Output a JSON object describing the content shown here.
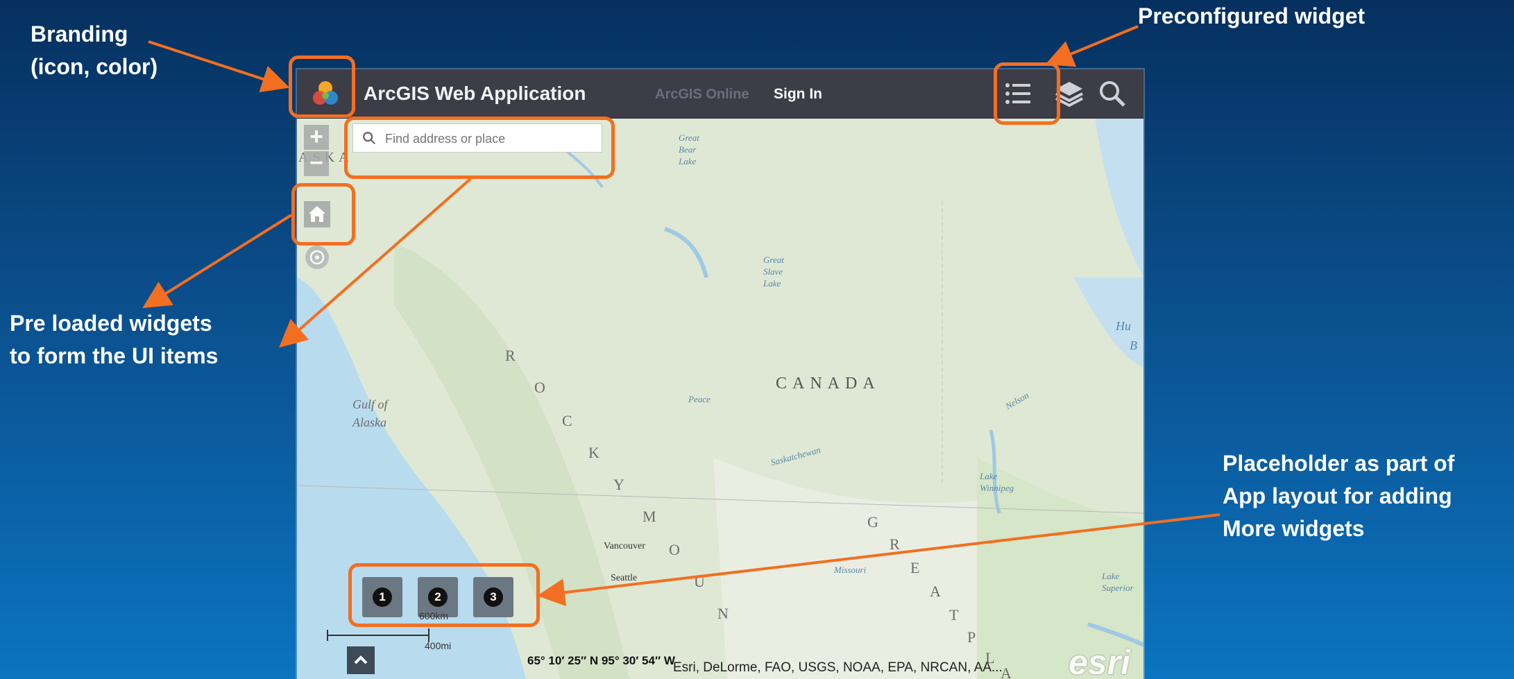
{
  "callouts": {
    "branding": [
      "Branding",
      "(icon, color)"
    ],
    "preconfigured": [
      "Preconfigured widget"
    ],
    "preloaded": [
      "Pre loaded widgets",
      "to form the UI items"
    ],
    "placeholder": [
      "Placeholder as part of",
      "App layout for adding",
      "More widgets"
    ]
  },
  "app": {
    "title": "ArcGIS Web Application",
    "org_link": "ArcGIS Online",
    "sign_in": "Sign In",
    "search": {
      "placeholder": "Find address or place"
    },
    "header_icons": [
      "list-icon",
      "layers-icon",
      "search-icon"
    ],
    "zoom": {
      "in": "+",
      "out": "−"
    },
    "placeholder_widgets": [
      "1",
      "2",
      "3"
    ],
    "scale": {
      "km": "600km",
      "mi": "400mi"
    },
    "coordinates": "65° 10′ 25″ N 95° 30′ 54″ W",
    "attribution": "Esri, DeLorme, FAO, USGS, NOAA, EPA, NRCAN, AA...",
    "esri_logo": "esri"
  },
  "map_labels": {
    "canada": "CANADA",
    "gulf_of_alaska": [
      "Gulf of",
      "Alaska"
    ],
    "great_bear_lake": [
      "Great",
      "Bear",
      "Lake"
    ],
    "great_slave_lake": [
      "Great",
      "Slave",
      "Lake"
    ],
    "lake_winnipeg": [
      "Lake",
      "Winnipeg"
    ],
    "lake_superior": [
      "Lake",
      "Superior"
    ],
    "vancouver": "Vancouver",
    "seattle": "Seattle",
    "missouri": "Missouri",
    "peace": "Peace",
    "saskatchewan": "Saskatchewan",
    "nelson": "Nelson",
    "rocky_mountains": [
      "R",
      "O",
      "C",
      "K",
      "Y",
      "M",
      "O",
      "U",
      "N"
    ],
    "great_plains": [
      "G",
      "R",
      "E",
      "A",
      "T",
      "P",
      "L",
      "A"
    ],
    "alaska": "ASKA",
    "hudson": [
      "Hu",
      "B"
    ]
  },
  "colors": {
    "accent": "#f26f21",
    "header_bg": "#3c3d47",
    "background_top": "#06305f",
    "background_bottom": "#0b74c0"
  }
}
